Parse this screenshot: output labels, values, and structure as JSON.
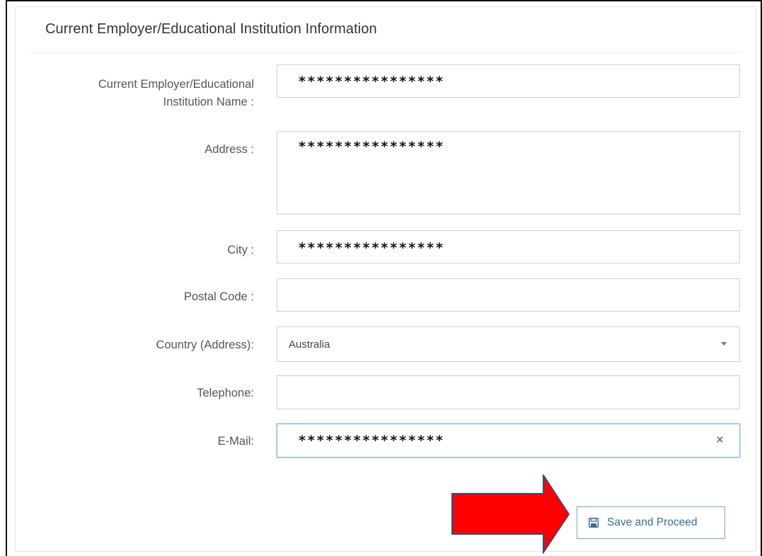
{
  "panel": {
    "title": "Current Employer/Educational Institution Information"
  },
  "form": {
    "employer_label_line1": "Current Employer/Educational",
    "employer_label_line2": "Institution Name :",
    "employer_value": "****************",
    "address_label": "Address :",
    "address_value": "****************",
    "city_label": "City :",
    "city_value": "****************",
    "postal_label": "Postal Code :",
    "postal_value": "",
    "country_label": "Country (Address):",
    "country_value": "Australia",
    "telephone_label": "Telephone:",
    "telephone_value": "",
    "email_label": "E-Mail:",
    "email_value": "****************",
    "email_clear": "×"
  },
  "actions": {
    "save_label": "Save and Proceed"
  },
  "icons": {
    "save": "floppy-disk-icon",
    "dropdown": "caret-down-icon",
    "clear": "close-icon",
    "pointer": "red-arrow-annotation"
  },
  "colors": {
    "arrow_fill": "#ff0000",
    "arrow_stroke": "#2f4f8a",
    "button_text": "#3a6e96"
  }
}
